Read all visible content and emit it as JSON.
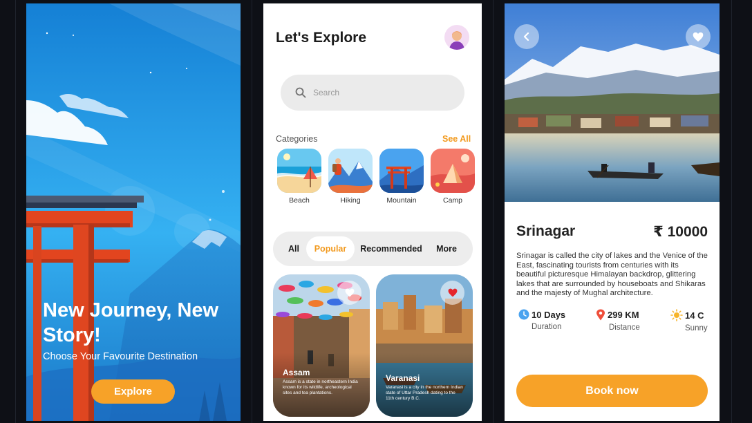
{
  "splash": {
    "title": "New Journey, New Story!",
    "subtitle": "Choose Your Favourite Destination",
    "cta_label": "Explore"
  },
  "explore": {
    "title": "Let's Explore",
    "search_placeholder": "Search",
    "categories_title": "Categories",
    "see_all_label": "See All",
    "categories": [
      {
        "label": "Beach",
        "icon": "beach-icon"
      },
      {
        "label": "Hiking",
        "icon": "hiking-icon"
      },
      {
        "label": "Mountain",
        "icon": "mountain-icon"
      },
      {
        "label": "Camp",
        "icon": "camp-icon"
      }
    ],
    "tabs": [
      {
        "label": "All",
        "active": false
      },
      {
        "label": "Popular",
        "active": true
      },
      {
        "label": "Recommended",
        "active": false
      },
      {
        "label": "More",
        "active": false
      }
    ],
    "cards": [
      {
        "title": "Assam",
        "description": "Assam is a state in northeastern India known for its wildlife, archeological sites and tea plantations.",
        "favorited": false
      },
      {
        "title": "Varanasi",
        "description": "Varanasi is a city in the northern Indian state of Uttar Pradesh dating to the 11th century B.C.",
        "favorited": true
      }
    ]
  },
  "detail": {
    "place": "Srinagar",
    "price": "₹ 10000",
    "description": "Srinagar is called the city of lakes and the Venice of the East, fascinating tourists from centuries with its beautiful picturesque Himalayan backdrop, glittering lakes that are surrounded by houseboats and Shikaras and the majesty of Mughal architecture.",
    "stats": [
      {
        "value": "10 Days",
        "label": "Duration",
        "icon": "clock-icon"
      },
      {
        "value": "299 KM",
        "label": "Distance",
        "icon": "location-pin-icon"
      },
      {
        "value": "14 C",
        "label": "Sunny",
        "icon": "sun-icon"
      }
    ],
    "cta_label": "Book now"
  },
  "colors": {
    "accent": "#f7a228",
    "accent_text": "#f29a1f",
    "favorite_red": "#e5252b"
  }
}
